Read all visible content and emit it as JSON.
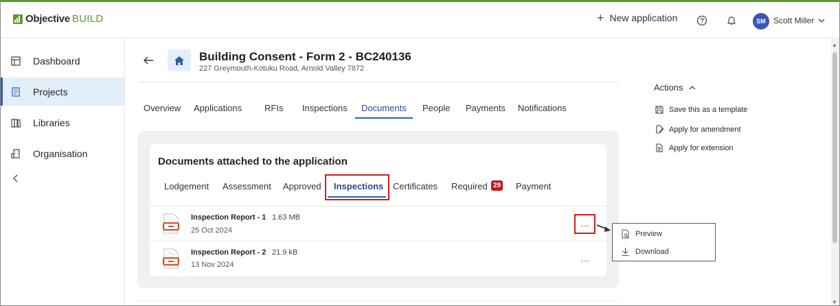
{
  "brand": {
    "strong": "Objective",
    "light": "BUILD",
    "color": "#5a9a2f"
  },
  "topbar": {
    "new_application": "New application",
    "user_initials": "SM",
    "user_name": "Scott Miller",
    "avatar_color": "#3b56b8",
    "icons": [
      "plus-icon",
      "help-icon",
      "bell-icon",
      "chevron-down-icon"
    ]
  },
  "sidebar": {
    "items": [
      {
        "label": "Dashboard",
        "icon": "dashboard-icon"
      },
      {
        "label": "Projects",
        "icon": "projects-icon",
        "active": true
      },
      {
        "label": "Libraries",
        "icon": "libraries-icon"
      },
      {
        "label": "Organisation",
        "icon": "organisation-icon"
      }
    ],
    "collapse_icon": "chevron-left-icon"
  },
  "header": {
    "title": "Building Consent - Form 2 - BC240136",
    "address": "227 Greymouth-Kotuku Road, Arnold Valley 7872",
    "icons": [
      "back-arrow-icon",
      "home-icon"
    ]
  },
  "main_tabs": [
    "Overview",
    "Applications",
    "RFIs",
    "Inspections",
    "Documents",
    "People",
    "Payments",
    "Notifications"
  ],
  "main_tab_active": "Documents",
  "documents": {
    "title": "Documents attached to the application",
    "tabs": [
      "Lodgement",
      "Assessment",
      "Approved",
      "Inspections",
      "Certificates",
      "Required",
      "Payment"
    ],
    "active_tab": "Inspections",
    "required_count": "29",
    "items": [
      {
        "name": "Inspection Report - 1",
        "size": "1.63 MB",
        "date": "25 Oct 2024"
      },
      {
        "name": "Inspection Report - 2",
        "size": "21.9 kB",
        "date": "13 Nov 2024"
      }
    ],
    "more_label": "..."
  },
  "context_menu": {
    "items": [
      {
        "label": "Preview",
        "icon": "preview-icon"
      },
      {
        "label": "Download",
        "icon": "download-icon"
      }
    ]
  },
  "actions": {
    "title": "Actions",
    "items": [
      {
        "label": "Save this as a template",
        "icon": "save-icon"
      },
      {
        "label": "Apply for amendment",
        "icon": "edit-document-icon"
      },
      {
        "label": "Apply for extension",
        "icon": "document-icon"
      }
    ]
  },
  "colors": {
    "accent": "#2d5fa8",
    "highlight": "#d11b1b",
    "badge": "#c4161c",
    "panel": "#eef0f3"
  }
}
